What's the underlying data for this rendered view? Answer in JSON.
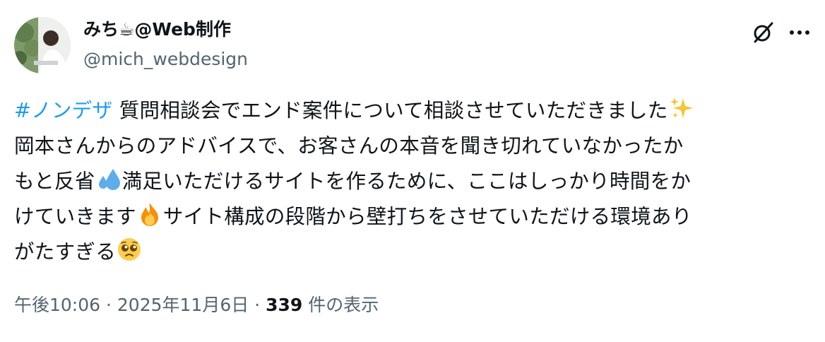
{
  "author": {
    "display_name": "みち☕@Web制作",
    "handle": "@mich_webdesign"
  },
  "icons": {
    "grok": "grok-icon",
    "more": "more-dots-icon"
  },
  "post": {
    "hashtag": "#ノンデザ",
    "line1_text": " 質問相談会でエンド案件について相談させていただきました",
    "line1_emoji": "sparkles",
    "line2_text": "岡本さんからのアドバイスで、お客さんの本音を聞き切れていなかったか",
    "line3_pre": "もと反省",
    "line3_emoji": "sweat-droplets",
    "line3_post": "満足いただけるサイトを作るために、ここはしっかり時間をか",
    "line4_pre": "けていきます",
    "line4_emoji": "fire",
    "line4_post": "サイト構成の段階から壁打ちをさせていただける環境あり",
    "line5_pre": "がたすぎる",
    "line5_emoji": "pleading-face"
  },
  "meta": {
    "time": "午後10:06",
    "separator1": " · ",
    "date": "2025年11月6日",
    "separator2": " · ",
    "views_count": "339",
    "views_label": " 件の表示"
  },
  "colors": {
    "link": "#1d9bf0",
    "secondary_text": "#536471",
    "primary_text": "#0f1419"
  }
}
